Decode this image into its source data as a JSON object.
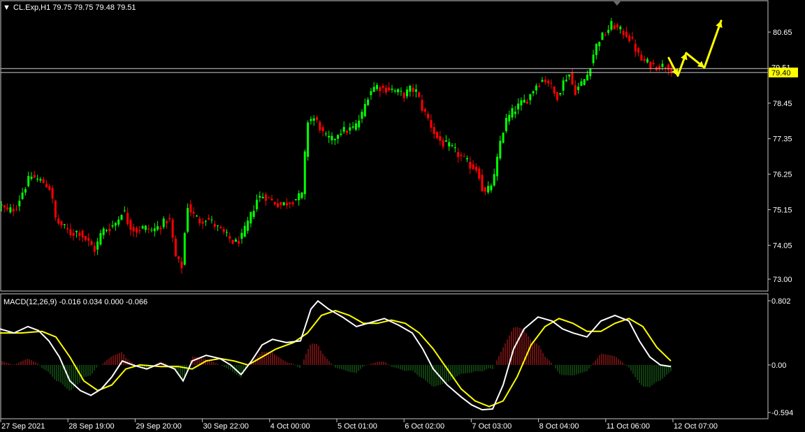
{
  "window": {
    "symbol_header": "CL.Exp,H1  79.75 79.75 79.48 79.51",
    "dropdown_glyph": "▼"
  },
  "colors": {
    "background": "#000000",
    "bull_candle": "#00ff00",
    "bear_candle": "#ff0000",
    "macd_main": "#ffffff",
    "macd_signal": "#ffff00",
    "hist_positive": "#cc2222",
    "hist_negative": "#1f7a1f",
    "level_line": "#cccccc",
    "price_box": "#ffff00",
    "arrows": "#ffff00"
  },
  "chart_data": [
    {
      "type": "candlestick",
      "title": "CL.Exp,H1",
      "y_ticks": [
        "80.65",
        "78.45",
        "77.35",
        "76.25",
        "75.15",
        "74.05",
        "73.00"
      ],
      "ylim": [
        72.55,
        81.35
      ],
      "x_labels": [
        "27 Sep 2021",
        "28 Sep 19:00",
        "29 Sep 20:00",
        "30 Sep 22:00",
        "4 Oct 00:00",
        "5 Oct 01:00",
        "6 Oct 02:00",
        "7 Oct 03:00",
        "8 Oct 04:00",
        "11 Oct 06:00",
        "12 Oct 07:00"
      ],
      "path": [
        [
          0,
          75.3
        ],
        [
          10,
          75.1
        ],
        [
          22,
          75.2
        ],
        [
          32,
          75.7
        ],
        [
          44,
          76.2
        ],
        [
          52,
          76.1
        ],
        [
          62,
          76.0
        ],
        [
          72,
          75.8
        ],
        [
          80,
          74.8
        ],
        [
          92,
          74.6
        ],
        [
          102,
          74.4
        ],
        [
          112,
          74.5
        ],
        [
          124,
          74.2
        ],
        [
          136,
          73.9
        ],
        [
          146,
          74.5
        ],
        [
          158,
          74.6
        ],
        [
          168,
          74.8
        ],
        [
          176,
          75.2
        ],
        [
          184,
          74.7
        ],
        [
          194,
          74.5
        ],
        [
          206,
          74.6
        ],
        [
          218,
          74.5
        ],
        [
          232,
          74.7
        ],
        [
          242,
          74.9
        ],
        [
          252,
          73.6
        ],
        [
          260,
          73.4
        ],
        [
          268,
          75.3
        ],
        [
          276,
          75.0
        ],
        [
          286,
          74.8
        ],
        [
          296,
          74.9
        ],
        [
          306,
          74.7
        ],
        [
          316,
          74.5
        ],
        [
          326,
          74.3
        ],
        [
          336,
          74.1
        ],
        [
          346,
          74.3
        ],
        [
          356,
          74.8
        ],
        [
          368,
          75.5
        ],
        [
          378,
          75.6
        ],
        [
          390,
          75.4
        ],
        [
          402,
          75.3
        ],
        [
          414,
          75.4
        ],
        [
          424,
          75.5
        ],
        [
          432,
          75.6
        ],
        [
          440,
          77.9
        ],
        [
          448,
          78.0
        ],
        [
          456,
          77.8
        ],
        [
          464,
          77.4
        ],
        [
          476,
          77.3
        ],
        [
          486,
          77.6
        ],
        [
          496,
          77.6
        ],
        [
          508,
          77.7
        ],
        [
          518,
          78.1
        ],
        [
          528,
          78.8
        ],
        [
          538,
          79.0
        ],
        [
          548,
          78.9
        ],
        [
          558,
          78.9
        ],
        [
          568,
          78.8
        ],
        [
          578,
          78.7
        ],
        [
          588,
          78.9
        ],
        [
          596,
          78.8
        ],
        [
          604,
          78.3
        ],
        [
          614,
          77.9
        ],
        [
          624,
          77.4
        ],
        [
          634,
          77.2
        ],
        [
          644,
          77.1
        ],
        [
          654,
          76.9
        ],
        [
          664,
          76.7
        ],
        [
          674,
          76.5
        ],
        [
          684,
          76.4
        ],
        [
          692,
          75.6
        ],
        [
          700,
          75.8
        ],
        [
          708,
          76.2
        ],
        [
          716,
          77.3
        ],
        [
          724,
          77.9
        ],
        [
          734,
          78.2
        ],
        [
          744,
          78.4
        ],
        [
          756,
          78.6
        ],
        [
          766,
          79.0
        ],
        [
          778,
          79.2
        ],
        [
          786,
          79.1
        ],
        [
          796,
          78.6
        ],
        [
          806,
          79.1
        ],
        [
          814,
          79.4
        ],
        [
          822,
          78.8
        ],
        [
          830,
          79.0
        ],
        [
          840,
          79.3
        ],
        [
          848,
          79.9
        ],
        [
          856,
          80.4
        ],
        [
          866,
          80.6
        ],
        [
          876,
          80.9
        ],
        [
          886,
          80.7
        ],
        [
          896,
          80.6
        ],
        [
          906,
          80.3
        ],
        [
          916,
          79.8
        ],
        [
          926,
          79.7
        ],
        [
          936,
          79.6
        ],
        [
          946,
          79.6
        ],
        [
          956,
          79.6
        ],
        [
          962,
          79.5
        ]
      ],
      "level_lines": [
        79.52,
        79.4
      ],
      "price_label": "79.40",
      "price_label_hidden_text": "79.51",
      "forecast_arrows": [
        [
          [
            957,
            79.85
          ],
          [
            970,
            79.3
          ]
        ],
        [
          [
            970,
            79.3
          ],
          [
            982,
            80.0
          ]
        ],
        [
          [
            982,
            80.0
          ],
          [
            1008,
            79.55
          ]
        ],
        [
          [
            1008,
            79.55
          ],
          [
            1032,
            81.0
          ]
        ]
      ]
    },
    {
      "type": "macd",
      "title": "MACD(12,26,9) -0.016 0.034 0.000 -0.066",
      "y_ticks": [
        "0.802",
        "0.00",
        "-0.594"
      ],
      "ylim": [
        -0.62,
        0.82
      ],
      "main": [
        [
          0,
          0.45
        ],
        [
          20,
          0.4
        ],
        [
          40,
          0.48
        ],
        [
          55,
          0.43
        ],
        [
          70,
          0.3
        ],
        [
          85,
          0.1
        ],
        [
          100,
          -0.2
        ],
        [
          115,
          -0.32
        ],
        [
          130,
          -0.38
        ],
        [
          145,
          -0.3
        ],
        [
          160,
          -0.15
        ],
        [
          175,
          0.05
        ],
        [
          190,
          0.0
        ],
        [
          210,
          -0.05
        ],
        [
          230,
          0.02
        ],
        [
          250,
          -0.05
        ],
        [
          262,
          -0.2
        ],
        [
          275,
          0.05
        ],
        [
          295,
          0.12
        ],
        [
          315,
          0.08
        ],
        [
          330,
          0.0
        ],
        [
          345,
          -0.12
        ],
        [
          360,
          0.05
        ],
        [
          375,
          0.25
        ],
        [
          390,
          0.32
        ],
        [
          410,
          0.28
        ],
        [
          430,
          0.3
        ],
        [
          445,
          0.7
        ],
        [
          455,
          0.8
        ],
        [
          470,
          0.7
        ],
        [
          490,
          0.6
        ],
        [
          510,
          0.48
        ],
        [
          530,
          0.53
        ],
        [
          550,
          0.58
        ],
        [
          570,
          0.5
        ],
        [
          590,
          0.4
        ],
        [
          605,
          0.2
        ],
        [
          620,
          -0.05
        ],
        [
          640,
          -0.25
        ],
        [
          660,
          -0.4
        ],
        [
          675,
          -0.5
        ],
        [
          690,
          -0.56
        ],
        [
          705,
          -0.55
        ],
        [
          720,
          -0.25
        ],
        [
          735,
          0.2
        ],
        [
          750,
          0.45
        ],
        [
          770,
          0.6
        ],
        [
          790,
          0.55
        ],
        [
          805,
          0.45
        ],
        [
          820,
          0.4
        ],
        [
          840,
          0.35
        ],
        [
          860,
          0.55
        ],
        [
          880,
          0.62
        ],
        [
          900,
          0.55
        ],
        [
          915,
          0.3
        ],
        [
          930,
          0.1
        ],
        [
          945,
          0.0
        ],
        [
          960,
          -0.02
        ]
      ],
      "signal": [
        [
          0,
          0.4
        ],
        [
          30,
          0.4
        ],
        [
          60,
          0.42
        ],
        [
          80,
          0.35
        ],
        [
          100,
          0.1
        ],
        [
          120,
          -0.2
        ],
        [
          140,
          -0.32
        ],
        [
          160,
          -0.25
        ],
        [
          180,
          -0.05
        ],
        [
          200,
          0.0
        ],
        [
          230,
          -0.02
        ],
        [
          255,
          -0.02
        ],
        [
          275,
          -0.05
        ],
        [
          295,
          0.05
        ],
        [
          315,
          0.08
        ],
        [
          335,
          0.05
        ],
        [
          355,
          0.0
        ],
        [
          375,
          0.1
        ],
        [
          395,
          0.2
        ],
        [
          420,
          0.28
        ],
        [
          440,
          0.4
        ],
        [
          460,
          0.62
        ],
        [
          480,
          0.68
        ],
        [
          500,
          0.62
        ],
        [
          520,
          0.52
        ],
        [
          540,
          0.52
        ],
        [
          560,
          0.56
        ],
        [
          580,
          0.52
        ],
        [
          600,
          0.4
        ],
        [
          620,
          0.2
        ],
        [
          640,
          -0.05
        ],
        [
          660,
          -0.3
        ],
        [
          680,
          -0.45
        ],
        [
          700,
          -0.52
        ],
        [
          720,
          -0.45
        ],
        [
          740,
          -0.15
        ],
        [
          760,
          0.25
        ],
        [
          780,
          0.48
        ],
        [
          800,
          0.58
        ],
        [
          820,
          0.52
        ],
        [
          840,
          0.42
        ],
        [
          860,
          0.42
        ],
        [
          880,
          0.52
        ],
        [
          900,
          0.58
        ],
        [
          920,
          0.48
        ],
        [
          940,
          0.22
        ],
        [
          960,
          0.05
        ]
      ]
    }
  ]
}
